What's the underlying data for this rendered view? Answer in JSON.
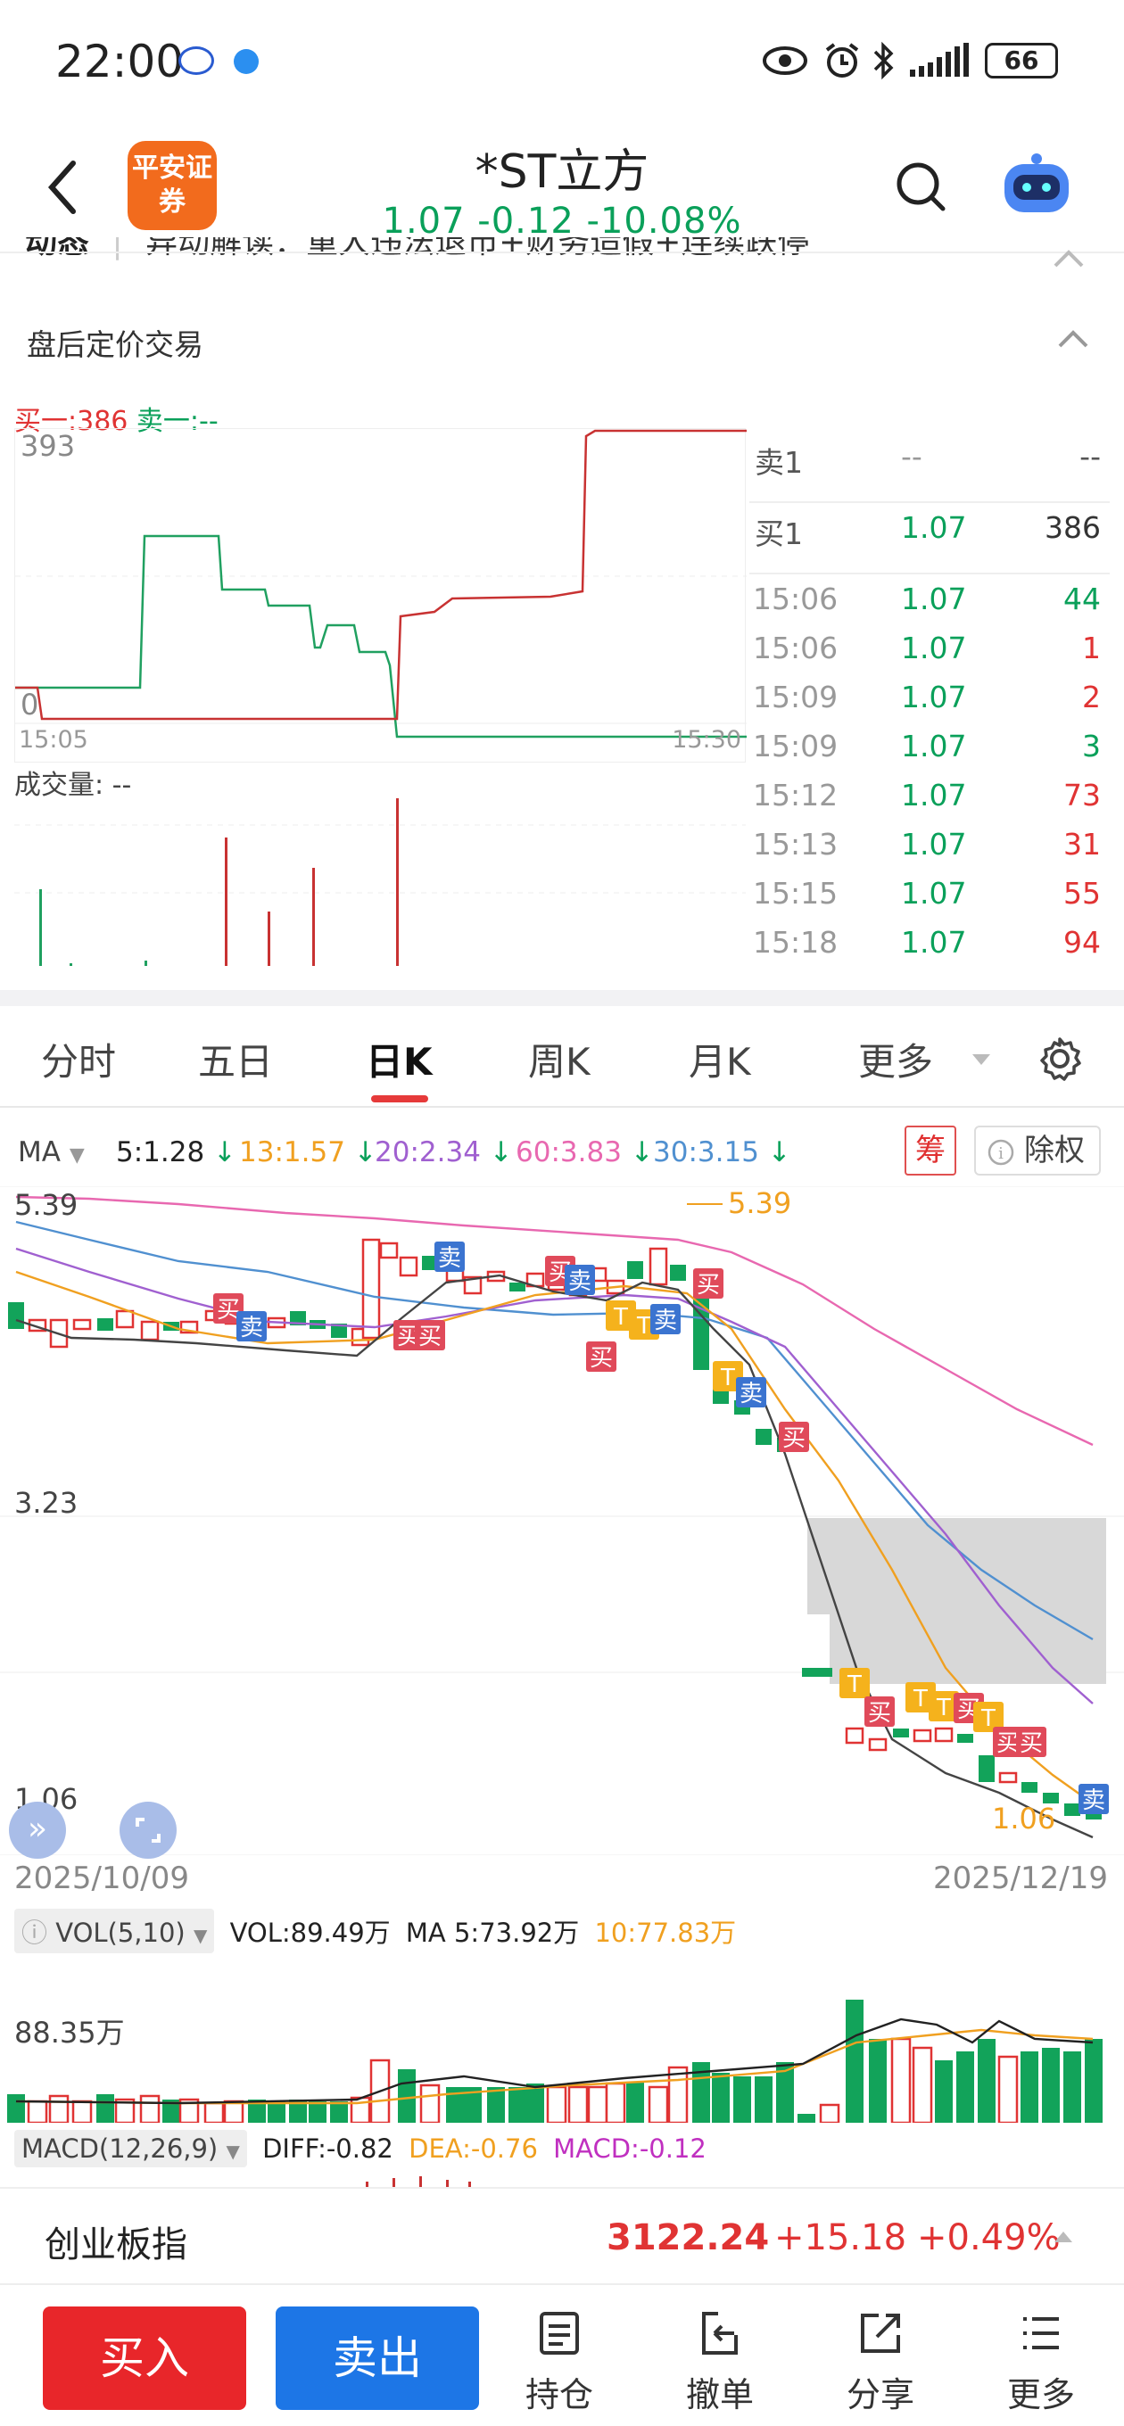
{
  "status": {
    "time": "22:00",
    "battery": "66"
  },
  "header": {
    "logo_text": "平安证券",
    "title": "*ST立方",
    "quote": "1.07  -0.12  -10.08%"
  },
  "news": {
    "label": "动态",
    "text": "异动解读：重大违法退市+财务造假+连续跌停"
  },
  "after_hours": {
    "section_title": "盘后定价交易",
    "buy1_legend": "买一:386",
    "sell1_legend": "卖一:--",
    "ymax": "393",
    "ymin": "0",
    "t_start": "15:05",
    "t_end": "15:30",
    "vol_label": "成交量: --",
    "book": [
      {
        "label": "卖1",
        "price": "--",
        "qty": "--"
      },
      {
        "label": "买1",
        "price": "1.07",
        "qty": "386"
      }
    ],
    "trades": [
      {
        "time": "15:06",
        "price": "1.07",
        "qty": "44",
        "side": "sell"
      },
      {
        "time": "15:06",
        "price": "1.07",
        "qty": "1",
        "side": "buy"
      },
      {
        "time": "15:09",
        "price": "1.07",
        "qty": "2",
        "side": "buy"
      },
      {
        "time": "15:09",
        "price": "1.07",
        "qty": "3",
        "side": "sell"
      },
      {
        "time": "15:12",
        "price": "1.07",
        "qty": "73",
        "side": "buy"
      },
      {
        "time": "15:13",
        "price": "1.07",
        "qty": "31",
        "side": "buy"
      },
      {
        "time": "15:15",
        "price": "1.07",
        "qty": "55",
        "side": "buy"
      },
      {
        "time": "15:18",
        "price": "1.07",
        "qty": "94",
        "side": "buy"
      }
    ]
  },
  "tabs": [
    "分时",
    "五日",
    "日K",
    "周K",
    "月K",
    "更多"
  ],
  "active_tab": "日K",
  "ma": {
    "label": "MA",
    "items": [
      {
        "text": "5:1.28",
        "color": "#222222"
      },
      {
        "text": "13:1.57",
        "color": "#f0a020"
      },
      {
        "text": "20:2.34",
        "color": "#a060d0"
      },
      {
        "text": "60:3.83",
        "color": "#e868b0"
      },
      {
        "text": "30:3.15",
        "color": "#5090d0"
      }
    ],
    "chou": "筹",
    "chuquan": "除权"
  },
  "kchart": {
    "y_top": "5.39",
    "y_mid": "3.23",
    "y_bottom": "1.06",
    "high_label": "5.39",
    "low_label": "1.06",
    "date_start": "2025/10/09",
    "date_end": "2025/12/19"
  },
  "vol": {
    "selector": "VOL(5,10)",
    "vol": "VOL:89.49万",
    "ma5": "MA 5:73.92万",
    "ma10": "10:77.83万",
    "scale": "88.35万"
  },
  "macd": {
    "selector": "MACD(12,26,9)",
    "diff": "DIFF:-0.82",
    "dea": "DEA:-0.76",
    "macd": "MACD:-0.12"
  },
  "index": {
    "name": "创业板指",
    "value": "3122.24",
    "change": "+15.18",
    "pct": "+0.49%"
  },
  "bottom": {
    "buy": "买入",
    "sell": "卖出",
    "items": [
      "持仓",
      "撤单",
      "分享",
      "更多"
    ]
  },
  "colors": {
    "up": "#e03333",
    "down": "#0aa05a",
    "accent": "#1d76e6"
  }
}
